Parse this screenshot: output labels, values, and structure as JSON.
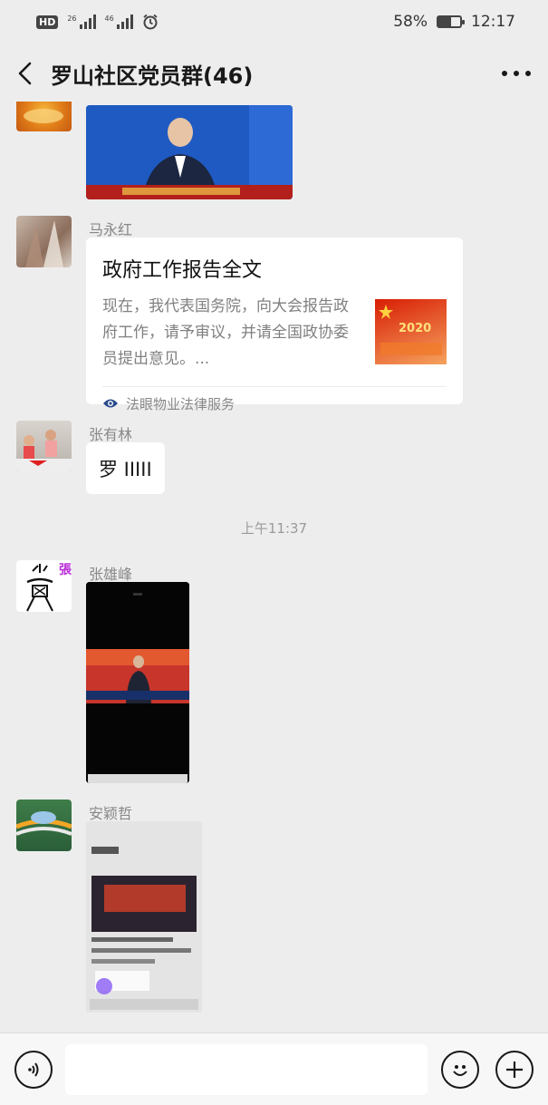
{
  "status_bar": {
    "hd": "HD",
    "sim1_label": "26",
    "sim2_label": "46",
    "battery": "58%",
    "battery_level": 0.58,
    "time": "12:17"
  },
  "header": {
    "title": "罗山社区党员群(46)",
    "back_icon": "back-chevron-icon",
    "more_icon": "more-dots-icon"
  },
  "messages": [
    {
      "type": "image",
      "sender": "",
      "description_icon": "video-thumbnail"
    },
    {
      "type": "link",
      "sender": "马永红",
      "title": "政府工作报告全文",
      "description": "现在，我代表国务院，向大会报告政府工作，请予审议，并请全国政协委员提出意见。...",
      "source": "法眼物业法律服务",
      "thumb_text": "2020"
    },
    {
      "type": "text",
      "sender": "张有林",
      "text": "罗 IIIII"
    },
    {
      "type": "time",
      "text": "上午11:37"
    },
    {
      "type": "video",
      "sender": "张雄峰",
      "avatar_char": "張"
    },
    {
      "type": "screenshot",
      "sender": "安颖哲"
    }
  ],
  "input_bar": {
    "voice_icon": "voice-icon",
    "emoji_icon": "emoji-icon",
    "plus_icon": "plus-icon"
  },
  "colors": {
    "background": "#ededed",
    "bubble": "#ffffff",
    "meta_text": "#888888"
  }
}
